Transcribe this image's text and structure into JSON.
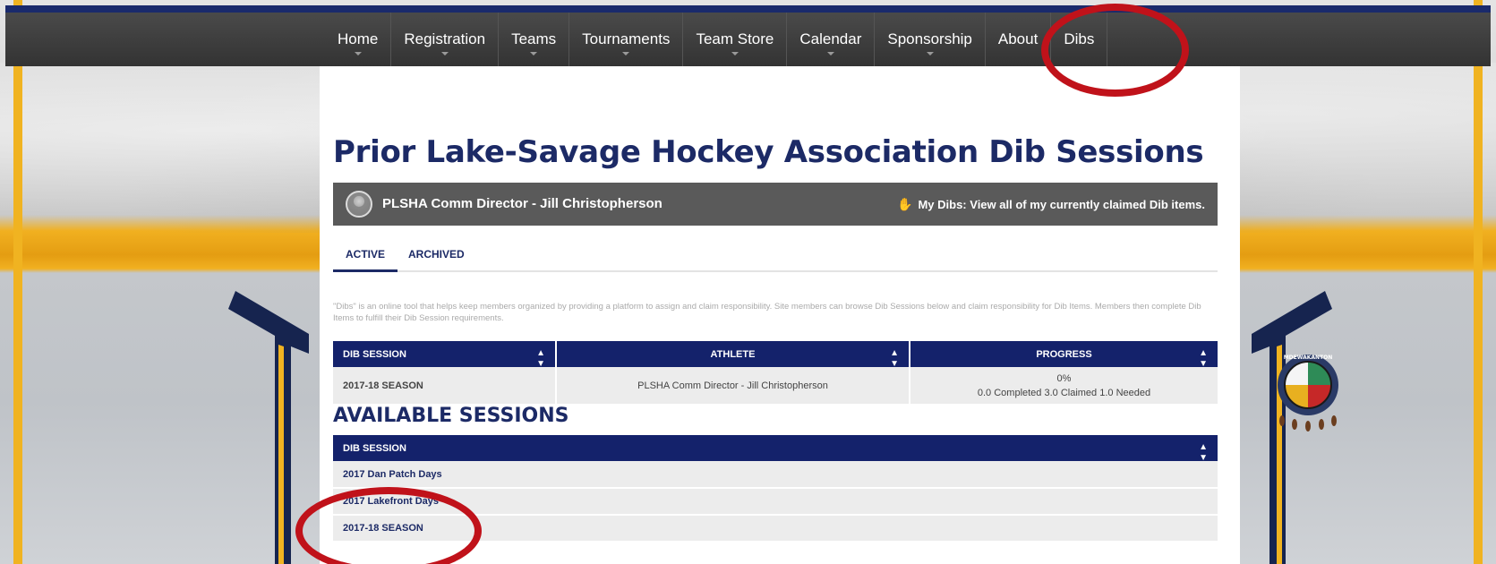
{
  "nav": {
    "items": [
      {
        "label": "Home",
        "has_dropdown": true
      },
      {
        "label": "Registration",
        "has_dropdown": true
      },
      {
        "label": "Teams",
        "has_dropdown": true
      },
      {
        "label": "Tournaments",
        "has_dropdown": true
      },
      {
        "label": "Team Store",
        "has_dropdown": true
      },
      {
        "label": "Calendar",
        "has_dropdown": true
      },
      {
        "label": "Sponsorship",
        "has_dropdown": true
      },
      {
        "label": "About",
        "has_dropdown": false
      },
      {
        "label": "Dibs",
        "has_dropdown": false
      }
    ]
  },
  "page": {
    "title": "Prior Lake-Savage Hockey Association Dib Sessions"
  },
  "user_bar": {
    "name": "PLSHA Comm Director - Jill Christopherson",
    "my_dibs_icon": "hand-icon",
    "my_dibs": "My Dibs: View all of my currently claimed Dib items."
  },
  "tabs": {
    "active": "ACTIVE",
    "archived": "ARCHIVED"
  },
  "info_text": "\"Dibs\" is an online tool that helps keep members organized by providing a platform to assign and claim responsibility. Site members can browse Dib Sessions below and claim responsibility for Dib Items. Members then complete Dib Items to fulfill their Dib Session requirements.",
  "my_sessions": {
    "headers": [
      "DIB SESSION",
      "ATHLETE",
      "PROGRESS"
    ],
    "row": {
      "session": "2017-18 SEASON",
      "athlete": "PLSHA Comm Director - Jill Christopherson",
      "progress_percent": "0%",
      "progress_detail": "0.0 Completed 3.0 Claimed 1.0 Needed"
    }
  },
  "available": {
    "title": "AVAILABLE SESSIONS",
    "header": "DIB SESSION",
    "rows": [
      "2017 Dan Patch Days",
      "2017 Lakefront Days",
      "2017-18 SEASON"
    ]
  },
  "logo": {
    "text": "MDEWAKANTON"
  },
  "colors": {
    "navy": "#1c2a66",
    "header_navy": "#14226b",
    "gold": "#f0b321",
    "annotation_red": "#c0121a"
  }
}
